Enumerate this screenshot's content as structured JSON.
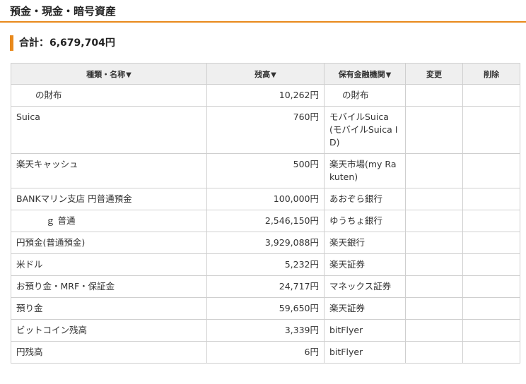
{
  "section": {
    "title": "預金・現金・暗号資産"
  },
  "total": {
    "label": "合計：",
    "amount": "6,679,704円"
  },
  "table": {
    "headers": {
      "name": "種類・名称",
      "balance": "残高",
      "institution": "保有金融機関",
      "edit": "変更",
      "delete": "削除"
    },
    "sort_arrow": "▼",
    "rows": [
      {
        "name": "の財布",
        "balance": "10,262円",
        "institution": "の財布"
      },
      {
        "name": "Suica",
        "balance": "760円",
        "institution": "モバイルSuica (モバイルSuica ID)"
      },
      {
        "name": "楽天キャッシュ",
        "balance": "500円",
        "institution": "楽天市場(my Rakuten)"
      },
      {
        "name": "BANKマリン支店 円普通預金",
        "balance": "100,000円",
        "institution": "あおぞら銀行"
      },
      {
        "name": "ｇ 普通",
        "balance": "2,546,150円",
        "institution": "ゆうちょ銀行"
      },
      {
        "name": "円預金(普通預金)",
        "balance": "3,929,088円",
        "institution": "楽天銀行"
      },
      {
        "name": "米ドル",
        "balance": "5,232円",
        "institution": "楽天証券"
      },
      {
        "name": "お預り金・MRF・保証金",
        "balance": "24,717円",
        "institution": "マネックス証券"
      },
      {
        "name": "預り金",
        "balance": "59,650円",
        "institution": "楽天証券"
      },
      {
        "name": "ビットコイン残高",
        "balance": "3,339円",
        "institution": "bitFlyer"
      },
      {
        "name": "円残高",
        "balance": "6円",
        "institution": "bitFlyer"
      }
    ]
  }
}
